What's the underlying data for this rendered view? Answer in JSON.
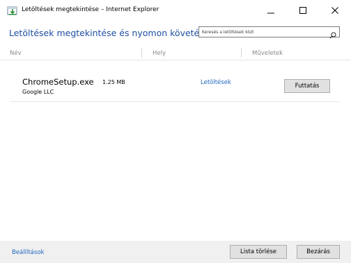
{
  "window": {
    "title": "Letöltések megtekintése – Internet Explorer"
  },
  "header": {
    "title": "Letöltések megtekintése és nyomon követése",
    "search_placeholder": "Keresés a letöltések közt"
  },
  "columns": {
    "name": "Név",
    "location": "Hely",
    "actions": "Műveletek"
  },
  "downloads": [
    {
      "name": "ChromeSetup.exe",
      "size": "1.25 MB",
      "publisher": "Google LLC",
      "location": "Letöltések",
      "action": "Futtatás"
    }
  ],
  "footer": {
    "settings": "Beállítások",
    "clear_list": "Lista törlése",
    "close": "Bezárás"
  },
  "colors": {
    "accent": "#1e4fa1",
    "link": "#1e66c0"
  },
  "icons": {
    "app": "ie-download-icon",
    "search": "search-icon",
    "minimize": "minimize-icon",
    "maximize": "maximize-icon",
    "close": "close-icon"
  }
}
